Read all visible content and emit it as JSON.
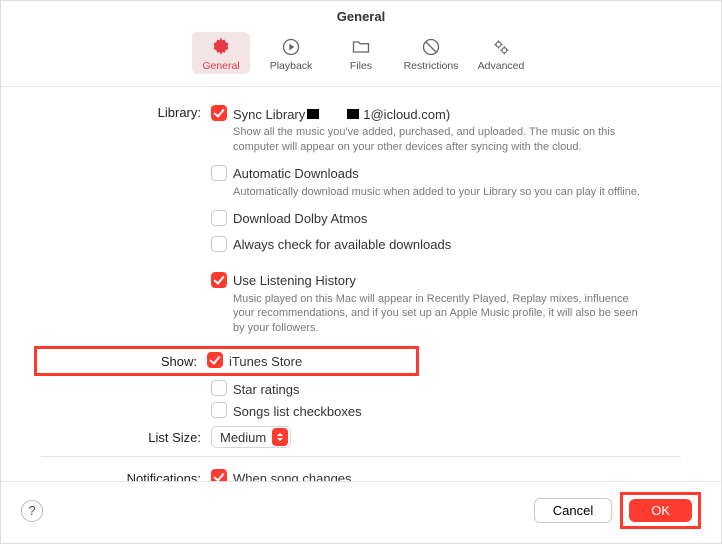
{
  "window_title": "General",
  "tabs": {
    "general": "General",
    "playback": "Playback",
    "files": "Files",
    "restrictions": "Restrictions",
    "advanced": "Advanced"
  },
  "labels": {
    "library": "Library:",
    "show": "Show:",
    "list_size": "List Size:",
    "notifications": "Notifications:"
  },
  "library": {
    "sync": {
      "label_prefix": "Sync Library",
      "account_suffix": "1@icloud.com)",
      "desc": "Show all the music you've added, purchased, and uploaded. The music on this computer will appear on your other devices after syncing with the cloud."
    },
    "auto_downloads": {
      "label": "Automatic Downloads",
      "desc": "Automatically download music when added to your Library so you can play it offline."
    },
    "dolby": {
      "label": "Download Dolby Atmos"
    },
    "check_downloads": {
      "label": "Always check for available downloads"
    },
    "listening_history": {
      "label": "Use Listening History",
      "desc": "Music played on this Mac will appear in Recently Played, Replay mixes, influence your recommendations, and if you set up an Apple Music profile, it will also be seen by your followers."
    }
  },
  "show": {
    "itunes_store": "iTunes Store",
    "star_ratings": "Star ratings",
    "songs_checkboxes": "Songs list checkboxes"
  },
  "list_size": {
    "value": "Medium"
  },
  "notifications": {
    "song_changes": "When song changes"
  },
  "footer": {
    "help": "?",
    "cancel": "Cancel",
    "ok": "OK"
  }
}
